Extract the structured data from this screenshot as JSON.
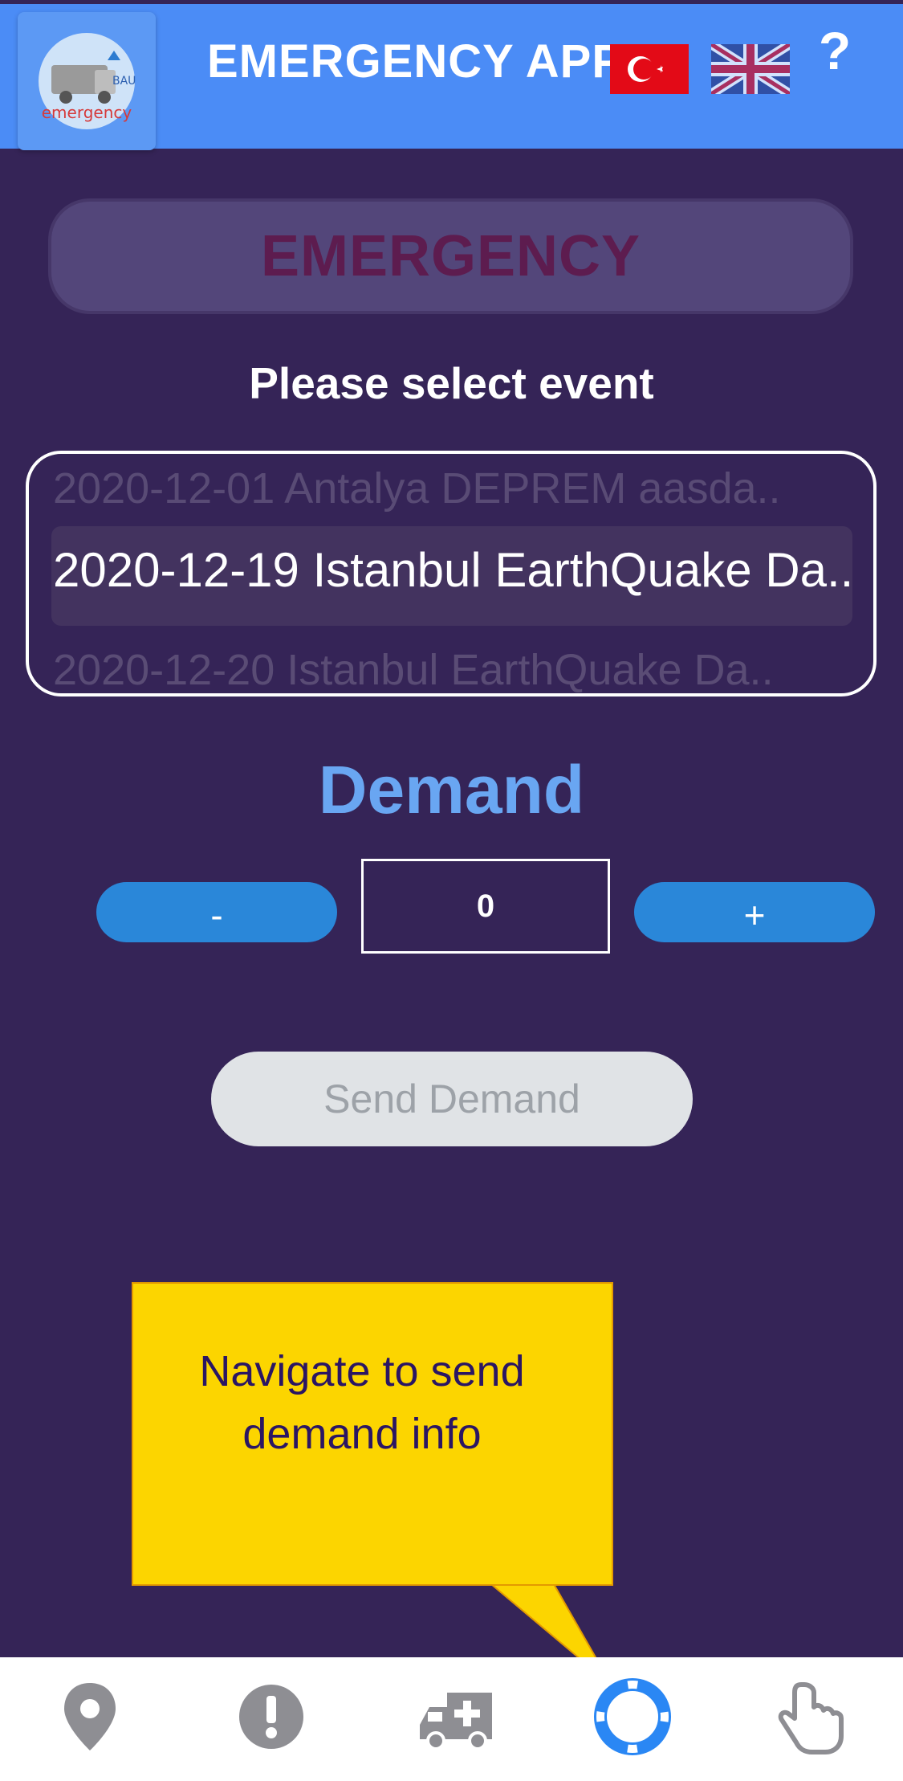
{
  "header": {
    "title": "EMERGENCY APP",
    "logo_icon": "app-logo-icon",
    "logo_text": "emergency",
    "help_label": "?"
  },
  "emergency_button": {
    "label": "EMERGENCY"
  },
  "event_select": {
    "label": "Please select event",
    "options": [
      "2020-12-01 Antalya DEPREM aasda..",
      "2020-12-19 Istanbul EarthQuake Da..",
      "2020-12-20 Istanbul EarthQuake Da.."
    ],
    "selected_index": 1
  },
  "demand": {
    "title": "Demand",
    "minus_label": "-",
    "plus_label": "+",
    "quantity": "0",
    "send_label": "Send Demand"
  },
  "tooltip": {
    "text": "Navigate to send demand info"
  },
  "tab_bar": {
    "items": [
      {
        "icon": "map-pin-icon"
      },
      {
        "icon": "alert-icon"
      },
      {
        "icon": "ambulance-icon"
      },
      {
        "icon": "lifebuoy-icon",
        "active": true
      },
      {
        "icon": "hand-pointer-icon"
      }
    ]
  },
  "colors": {
    "background": "#352457",
    "header": "#4b8cf6",
    "accent_blue": "#2a87d9",
    "demand_title": "#69a6f2",
    "active_tab": "#2a87f4",
    "inactive_tab": "#8e8e93",
    "tooltip": "#fcd500"
  }
}
